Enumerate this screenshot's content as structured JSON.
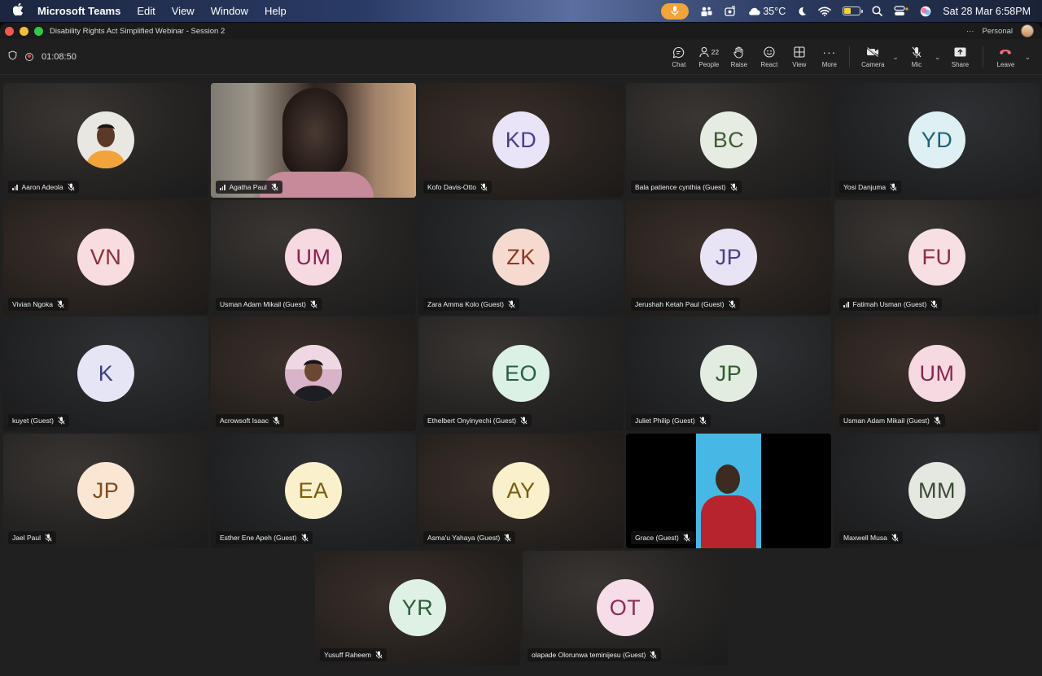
{
  "menubar": {
    "app_name": "Microsoft Teams",
    "menus": [
      "Edit",
      "View",
      "Window",
      "Help"
    ],
    "temperature": "35°C",
    "datetime": "Sat 28 Mar  6:58PM"
  },
  "window": {
    "title": "Disability Rights Act Simplified Webinar - Session 2",
    "account": "Personal"
  },
  "meeting": {
    "timer": "01:08:50",
    "people_count": "22"
  },
  "toolbar": {
    "chat": "Chat",
    "people": "People",
    "raise": "Raise",
    "react": "React",
    "view": "View",
    "more": "More",
    "camera": "Camera",
    "mic": "Mic",
    "share": "Share",
    "leave": "Leave"
  },
  "participants": [
    {
      "name": "Aaron Adeola",
      "initials": "",
      "kind": "photo",
      "signal": true
    },
    {
      "name": "Agatha Paul",
      "initials": "",
      "kind": "video",
      "signal": true
    },
    {
      "name": "Kofo Davis-Otto",
      "initials": "KD",
      "bg": "#e9e4f7",
      "fg": "#4b3f86"
    },
    {
      "name": "Bala patience cynthia (Guest)",
      "initials": "BC",
      "bg": "#e6ece1",
      "fg": "#3f5a35"
    },
    {
      "name": "Yosi Danjuma",
      "initials": "YD",
      "bg": "#def0f3",
      "fg": "#1f6276"
    },
    {
      "name": "Vivian Ngoka",
      "initials": "VN",
      "bg": "#f7dde0",
      "fg": "#8a2e3b"
    },
    {
      "name": "Usman Adam Mikail (Guest)",
      "initials": "UM",
      "bg": "#f7d9e2",
      "fg": "#8b2450"
    },
    {
      "name": "Zara Amma Kolo (Guest)",
      "initials": "ZK",
      "bg": "#f6d9cf",
      "fg": "#8a3a22"
    },
    {
      "name": "Jerushah Ketah Paul (Guest)",
      "initials": "JP",
      "bg": "#e8e4f5",
      "fg": "#4c3f84"
    },
    {
      "name": "Fatimah Usman (Guest)",
      "initials": "FU",
      "bg": "#f7dfe4",
      "fg": "#8b2c44",
      "signal": true
    },
    {
      "name": "kuyet (Guest)",
      "initials": "K",
      "bg": "#e6e5f6",
      "fg": "#3f3d80"
    },
    {
      "name": "Acrowsoft Isaac",
      "initials": "",
      "kind": "photo2"
    },
    {
      "name": "Ethelbert Onyinyechi (Guest)",
      "initials": "EO",
      "bg": "#dcf1e5",
      "fg": "#236144"
    },
    {
      "name": "Juliet Philip (Guest)",
      "initials": "JP",
      "bg": "#e2ece1",
      "fg": "#2f5b2f"
    },
    {
      "name": "Usman Adam Mikail (Guest)",
      "initials": "UM",
      "bg": "#f7d9e2",
      "fg": "#8b2450"
    },
    {
      "name": "Jael Paul",
      "initials": "JP",
      "bg": "#fae6d2",
      "fg": "#7d4b1d"
    },
    {
      "name": "Esther Ene Apeh (Guest)",
      "initials": "EA",
      "bg": "#fbf0cc",
      "fg": "#7a5c0d"
    },
    {
      "name": "Asma'u Yahaya (Guest)",
      "initials": "AY",
      "bg": "#fbf0cc",
      "fg": "#7a5c0d"
    },
    {
      "name": "Grace (Guest)",
      "initials": "",
      "kind": "video2"
    },
    {
      "name": "Maxwell Musa",
      "initials": "MM",
      "bg": "#e4e8e0",
      "fg": "#3b4a36"
    },
    {
      "name": "Yusuff Raheem",
      "initials": "YR",
      "bg": "#dff0e4",
      "fg": "#2c5b3b"
    },
    {
      "name": "olapade Olorunwa teminijesu (Guest)",
      "initials": "OT",
      "bg": "#f6dde8",
      "fg": "#8a2b58"
    }
  ]
}
